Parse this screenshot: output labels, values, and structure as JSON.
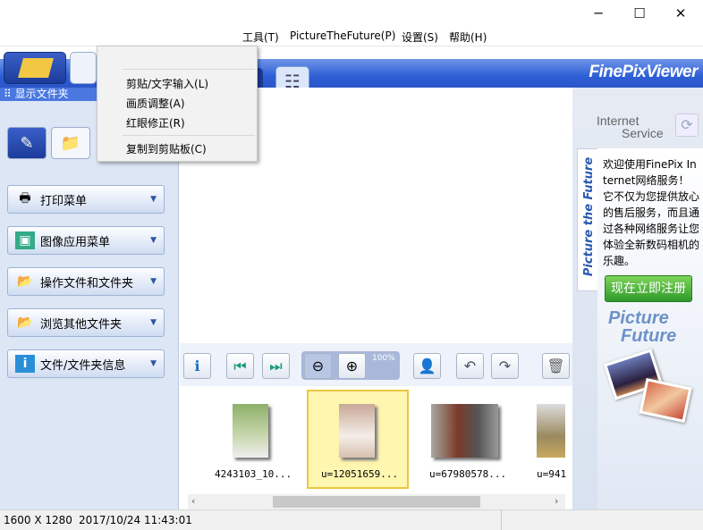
{
  "window": {
    "minimize": "─",
    "maximize": "☐",
    "close": "✕"
  },
  "menubar": {
    "items": [
      "工具(T)",
      "PictureTheFuture(P)",
      "设置(S)",
      "帮助(H)"
    ]
  },
  "brand": "FinePixViewer",
  "sidebar": {
    "header": "显示文件夹",
    "items": [
      {
        "label": "打印菜单",
        "icon": "printer-icon"
      },
      {
        "label": "图像应用菜单",
        "icon": "image-app-icon"
      },
      {
        "label": "操作文件和文件夹",
        "icon": "folder-operate-icon"
      },
      {
        "label": "浏览其他文件夹",
        "icon": "folder-browse-icon"
      },
      {
        "label": "文件/文件夹信息",
        "icon": "info-icon"
      }
    ]
  },
  "context_menu": {
    "items": [
      "剪贴/文字输入(L)",
      "画质调整(A)",
      "红眼修正(R)",
      "复制到剪贴板(C)"
    ]
  },
  "toolbar": {
    "zoom": "100%"
  },
  "thumbnails": [
    {
      "name": "4243103_10...",
      "selected": false
    },
    {
      "name": "u=12051659...",
      "selected": true
    },
    {
      "name": "u=67980578...",
      "selected": false
    },
    {
      "name": "u=941",
      "selected": false
    }
  ],
  "status": {
    "dimensions": "1600 X 1280",
    "datetime": "2017/10/24 11:43:01"
  },
  "right_panel": {
    "header_line1": "Internet",
    "header_line2": "Service",
    "tab": "Picture the Future",
    "text": "欢迎使用FinePix Internet网络服务！它不仅为您提供放心的售后服务，而且通过各种网络服务让您体验全新数码相机的乐趣。",
    "register": "现在立即注册",
    "logo_line1": "Picture",
    "logo_line2": "Future"
  },
  "colors": {
    "accent": "#2f5fd6",
    "selected": "#fff6b0",
    "register": "#3aa53a"
  }
}
